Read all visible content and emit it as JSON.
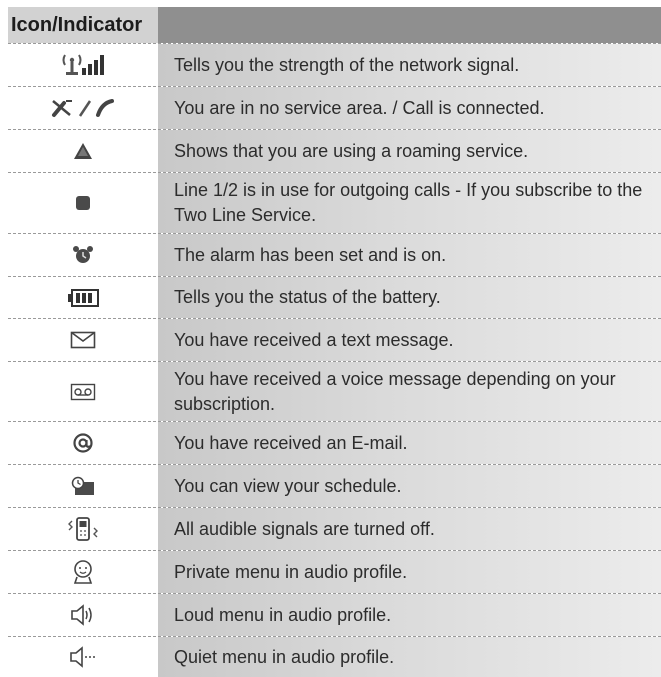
{
  "table": {
    "header": {
      "icon_col": "Icon/Indicator",
      "desc_col": ""
    },
    "rows": [
      {
        "icon": "signal-strength-icon",
        "description": "Tells you the strength of the network signal."
      },
      {
        "icon": "no-service-call-connected-icon",
        "description": "You are in no service area. / Call is connected."
      },
      {
        "icon": "roaming-icon",
        "description": "Shows that you are using a roaming service."
      },
      {
        "icon": "line-1-2-icon",
        "description": "Line 1/2 is in use for outgoing calls - If you subscribe to the Two Line Service."
      },
      {
        "icon": "alarm-clock-icon",
        "description": "The alarm has been set and is on."
      },
      {
        "icon": "battery-icon",
        "description": "Tells you the status of the battery."
      },
      {
        "icon": "envelope-icon",
        "description": "You have received a text message."
      },
      {
        "icon": "voice-message-icon",
        "description": "You have received a voice message depending on your subscription."
      },
      {
        "icon": "email-at-icon",
        "description": "You have received an E-mail."
      },
      {
        "icon": "schedule-icon",
        "description": "You can view your schedule."
      },
      {
        "icon": "silent-vibrate-icon",
        "description": "All audible signals are turned off."
      },
      {
        "icon": "private-profile-icon",
        "description": "Private menu in audio profile."
      },
      {
        "icon": "loud-speaker-icon",
        "description": "Loud menu in audio profile."
      },
      {
        "icon": "quiet-speaker-icon",
        "description": "Quiet menu in audio profile."
      }
    ]
  }
}
